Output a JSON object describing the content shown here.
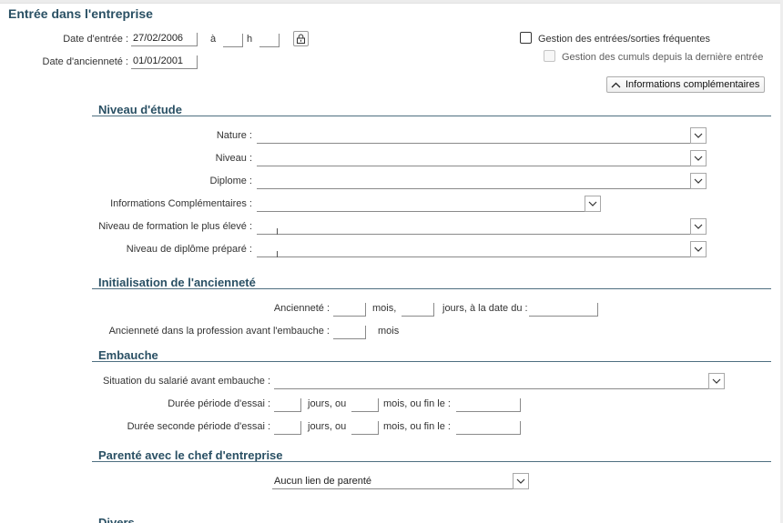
{
  "page": {
    "title": "Entrée dans l'entreprise"
  },
  "entry": {
    "date_entree_label": "Date d'entrée :",
    "date_entree_value": "27/02/2006",
    "a_label": "à",
    "h_label": "h",
    "date_anciennete_label": "Date d'ancienneté :",
    "date_anciennete_value": "01/01/2001",
    "frequent_label": "Gestion des entrées/sorties fréquentes",
    "frequent_checked": false,
    "cumuls_label": "Gestion des cumuls depuis la dernière entrée",
    "cumuls_checked": false,
    "cumuls_enabled": false,
    "info_button_label": "Informations complémentaires",
    "lock_icon": "lock-icon"
  },
  "niveau_etude": {
    "title": "Niveau d'étude",
    "nature_label": "Nature :",
    "nature_value": "",
    "niveau_label": "Niveau :",
    "niveau_value": "",
    "diplome_label": "Diplome :",
    "diplome_value": "",
    "infos_label": "Informations Complémentaires :",
    "infos_value": "",
    "formation_label": "Niveau de formation le plus élevé :",
    "formation_value": "",
    "prepare_label": "Niveau de diplôme préparé :",
    "prepare_value": ""
  },
  "anciennete": {
    "title": "Initialisation de l'ancienneté",
    "anciennete_label": "Ancienneté :",
    "mois_label": "mois,",
    "jours_label": "jours, à la date du :",
    "profession_label": "Ancienneté dans la profession avant l'embauche :",
    "profession_mois_label": "mois"
  },
  "embauche": {
    "title": "Embauche",
    "situation_label": "Situation du salarié avant embauche :",
    "situation_value": "",
    "essai_label": "Durée période d'essai :",
    "essai2_label": "Durée seconde période d'essai :",
    "jours_ou_label": "jours, ou",
    "mois_fin_label": "mois, ou fin le :"
  },
  "parente": {
    "title": "Parenté avec le chef d'entreprise",
    "value": "Aucun lien de parenté"
  },
  "divers": {
    "title": "Divers"
  }
}
